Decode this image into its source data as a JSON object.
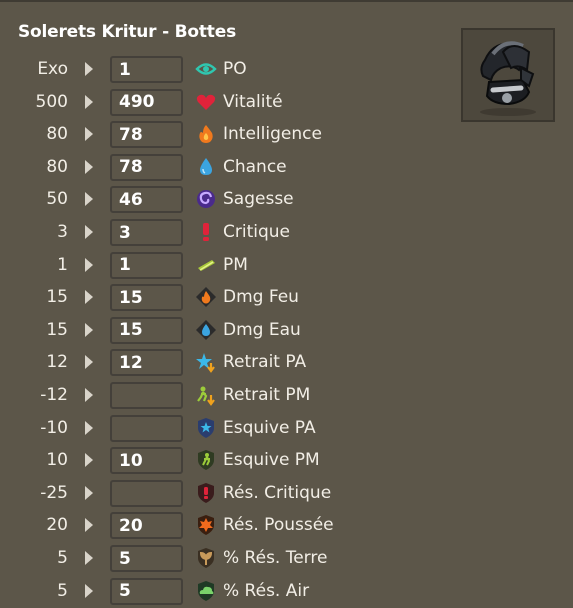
{
  "title": "Solerets Kritur - Bottes",
  "item_icon": "boots-item-icon",
  "stats": [
    {
      "base": "Exo",
      "value": "1",
      "label": "PO",
      "icon": "eye-icon"
    },
    {
      "base": "500",
      "value": "490",
      "label": "Vitalité",
      "icon": "heart-icon"
    },
    {
      "base": "80",
      "value": "78",
      "label": "Intelligence",
      "icon": "fire-icon"
    },
    {
      "base": "80",
      "value": "78",
      "label": "Chance",
      "icon": "water-drop-icon"
    },
    {
      "base": "50",
      "value": "46",
      "label": "Sagesse",
      "icon": "wisdom-swirl-icon"
    },
    {
      "base": "3",
      "value": "3",
      "label": "Critique",
      "icon": "exclamation-icon"
    },
    {
      "base": "1",
      "value": "1",
      "label": "PM",
      "icon": "movement-point-icon"
    },
    {
      "base": "15",
      "value": "15",
      "label": "Dmg Feu",
      "icon": "fire-damage-icon"
    },
    {
      "base": "15",
      "value": "15",
      "label": "Dmg Eau",
      "icon": "water-damage-icon"
    },
    {
      "base": "12",
      "value": "12",
      "label": "Retrait PA",
      "icon": "ap-removal-icon"
    },
    {
      "base": "-12",
      "value": "",
      "label": "Retrait PM",
      "icon": "mp-removal-icon"
    },
    {
      "base": "-10",
      "value": "",
      "label": "Esquive PA",
      "icon": "ap-dodge-icon"
    },
    {
      "base": "10",
      "value": "10",
      "label": "Esquive PM",
      "icon": "mp-dodge-icon"
    },
    {
      "base": "-25",
      "value": "",
      "label": "Rés. Critique",
      "icon": "critical-resistance-icon"
    },
    {
      "base": "20",
      "value": "20",
      "label": "Rés. Poussée",
      "icon": "pushback-resistance-icon"
    },
    {
      "base": "5",
      "value": "5",
      "label": "% Rés. Terre",
      "icon": "earth-resistance-icon"
    },
    {
      "base": "5",
      "value": "5",
      "label": "% Rés. Air",
      "icon": "air-resistance-icon"
    }
  ]
}
